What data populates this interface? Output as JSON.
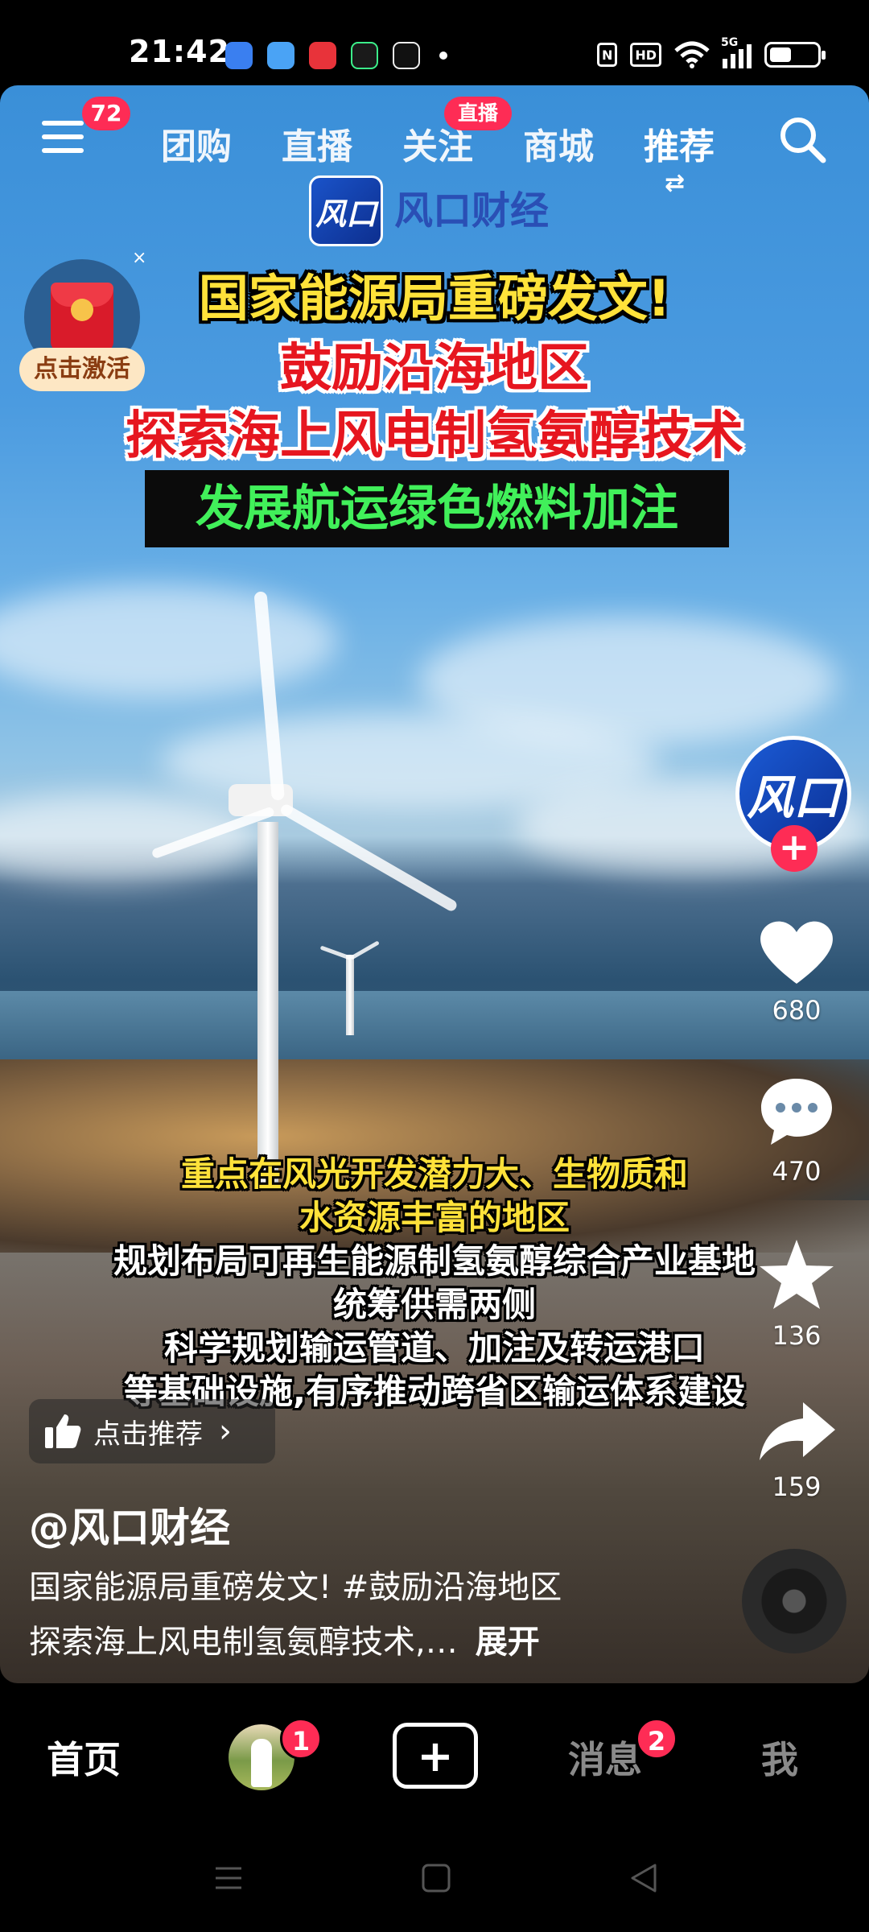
{
  "status_bar": {
    "time": "21:42",
    "apps": [
      {
        "icon": "blue-app-icon",
        "color": "#3a7ff0"
      },
      {
        "icon": "weather-app-icon",
        "color": "#4aa3f5"
      },
      {
        "icon": "red-app-icon",
        "color": "#e8333a"
      },
      {
        "icon": "music-app-icon",
        "color": "#1a1a1a"
      },
      {
        "icon": "tiktok-app-icon",
        "color": "#111111"
      }
    ],
    "network_label": "5G",
    "hd_label": "HD",
    "nfc_label": "N",
    "battery_level": 0.45
  },
  "top_nav": {
    "menu_badge": "72",
    "tabs": [
      "团购",
      "直播",
      "关注",
      "商城",
      "推荐"
    ],
    "active_tab": "推荐",
    "live_tag": "直播"
  },
  "overlay": {
    "brand_logo": "风口",
    "brand_name": "风口财经",
    "headline_1": "国家能源局重磅发文!",
    "headline_2": "鼓励沿海地区",
    "headline_3": "探索海上风电制氢氨醇技术",
    "headline_box": "发展航运绿色燃料加注",
    "subtitles": [
      "重点在风光开发潜力大、生物质和",
      "水资源丰富的地区",
      "规划布局可再生能源制氢氨醇综合产业基地",
      "统筹供需两侧",
      "科学规划输运管道、加注及转运港口",
      "等基础设施,有序推动跨省区输运体系建设"
    ]
  },
  "red_packet": {
    "label": "点击激活",
    "close": "×"
  },
  "side_rail": {
    "avatar_text": "风口",
    "likes": "680",
    "comments": "470",
    "favorites": "136",
    "shares": "159"
  },
  "info": {
    "recommend_label": "点击推荐",
    "author": "@风口财经",
    "desc_line_1": "国家能源局重磅发文! #鼓励沿海地区",
    "desc_line_2": "探索海上风电制氢氨醇技术,…",
    "expand_label": "展开"
  },
  "bottom_nav": {
    "home": "首页",
    "friends_badge": "1",
    "create": "+",
    "messages": "消息",
    "messages_badge": "2",
    "me": "我"
  },
  "colors": {
    "accent": "#fe2c55",
    "headline_yellow": "#ffe23a",
    "headline_red": "#e6161f",
    "headline_green": "#41f05a"
  }
}
